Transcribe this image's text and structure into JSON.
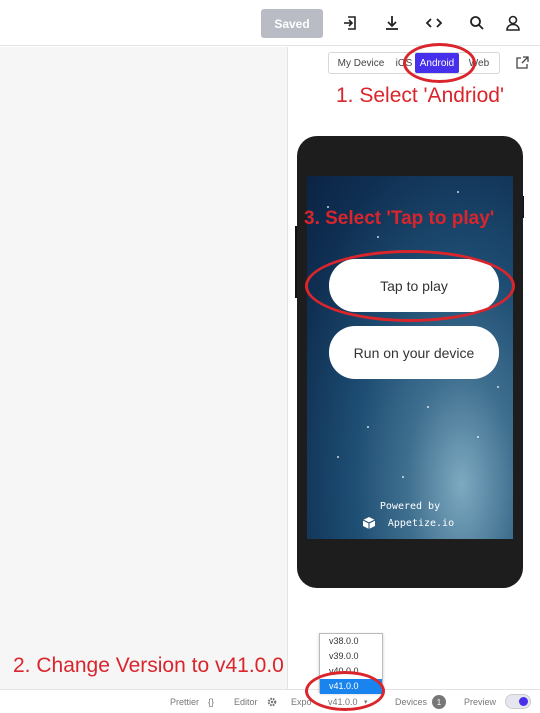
{
  "toolbar": {
    "saved_label": "Saved",
    "icons": [
      "log-in-icon",
      "download-icon",
      "code-icon",
      "search-icon",
      "user-icon"
    ]
  },
  "device_tabs": {
    "items": [
      "My Device",
      "iOS",
      "Android",
      "Web"
    ],
    "active": "Android"
  },
  "annotations": {
    "step1": "1. Select 'Andriod'",
    "step2": "2. Change Version to v41.0.0",
    "step3": "3. Select 'Tap to play'"
  },
  "phone_screen": {
    "tap_to_play": "Tap to play",
    "run_on_device": "Run on your device",
    "powered_by": "Powered by",
    "appetize": "Appetize.io"
  },
  "version_dropdown": {
    "options": [
      "v38.0.0",
      "v39.0.0",
      "v40.0.0",
      "v41.0.0"
    ],
    "selected": "v41.0.0"
  },
  "bottom_bar": {
    "prettier": "Prettier",
    "prettier_icon": "{}",
    "editor": "Editor",
    "expo": "Expo",
    "version": "v41.0.0",
    "devices": "Devices",
    "devices_count": "1",
    "preview": "Preview"
  },
  "colors": {
    "accent": "#4630eb",
    "annotation": "#d9252b",
    "saved_button": "#b9bcc4",
    "selected_option": "#1a84ee"
  }
}
